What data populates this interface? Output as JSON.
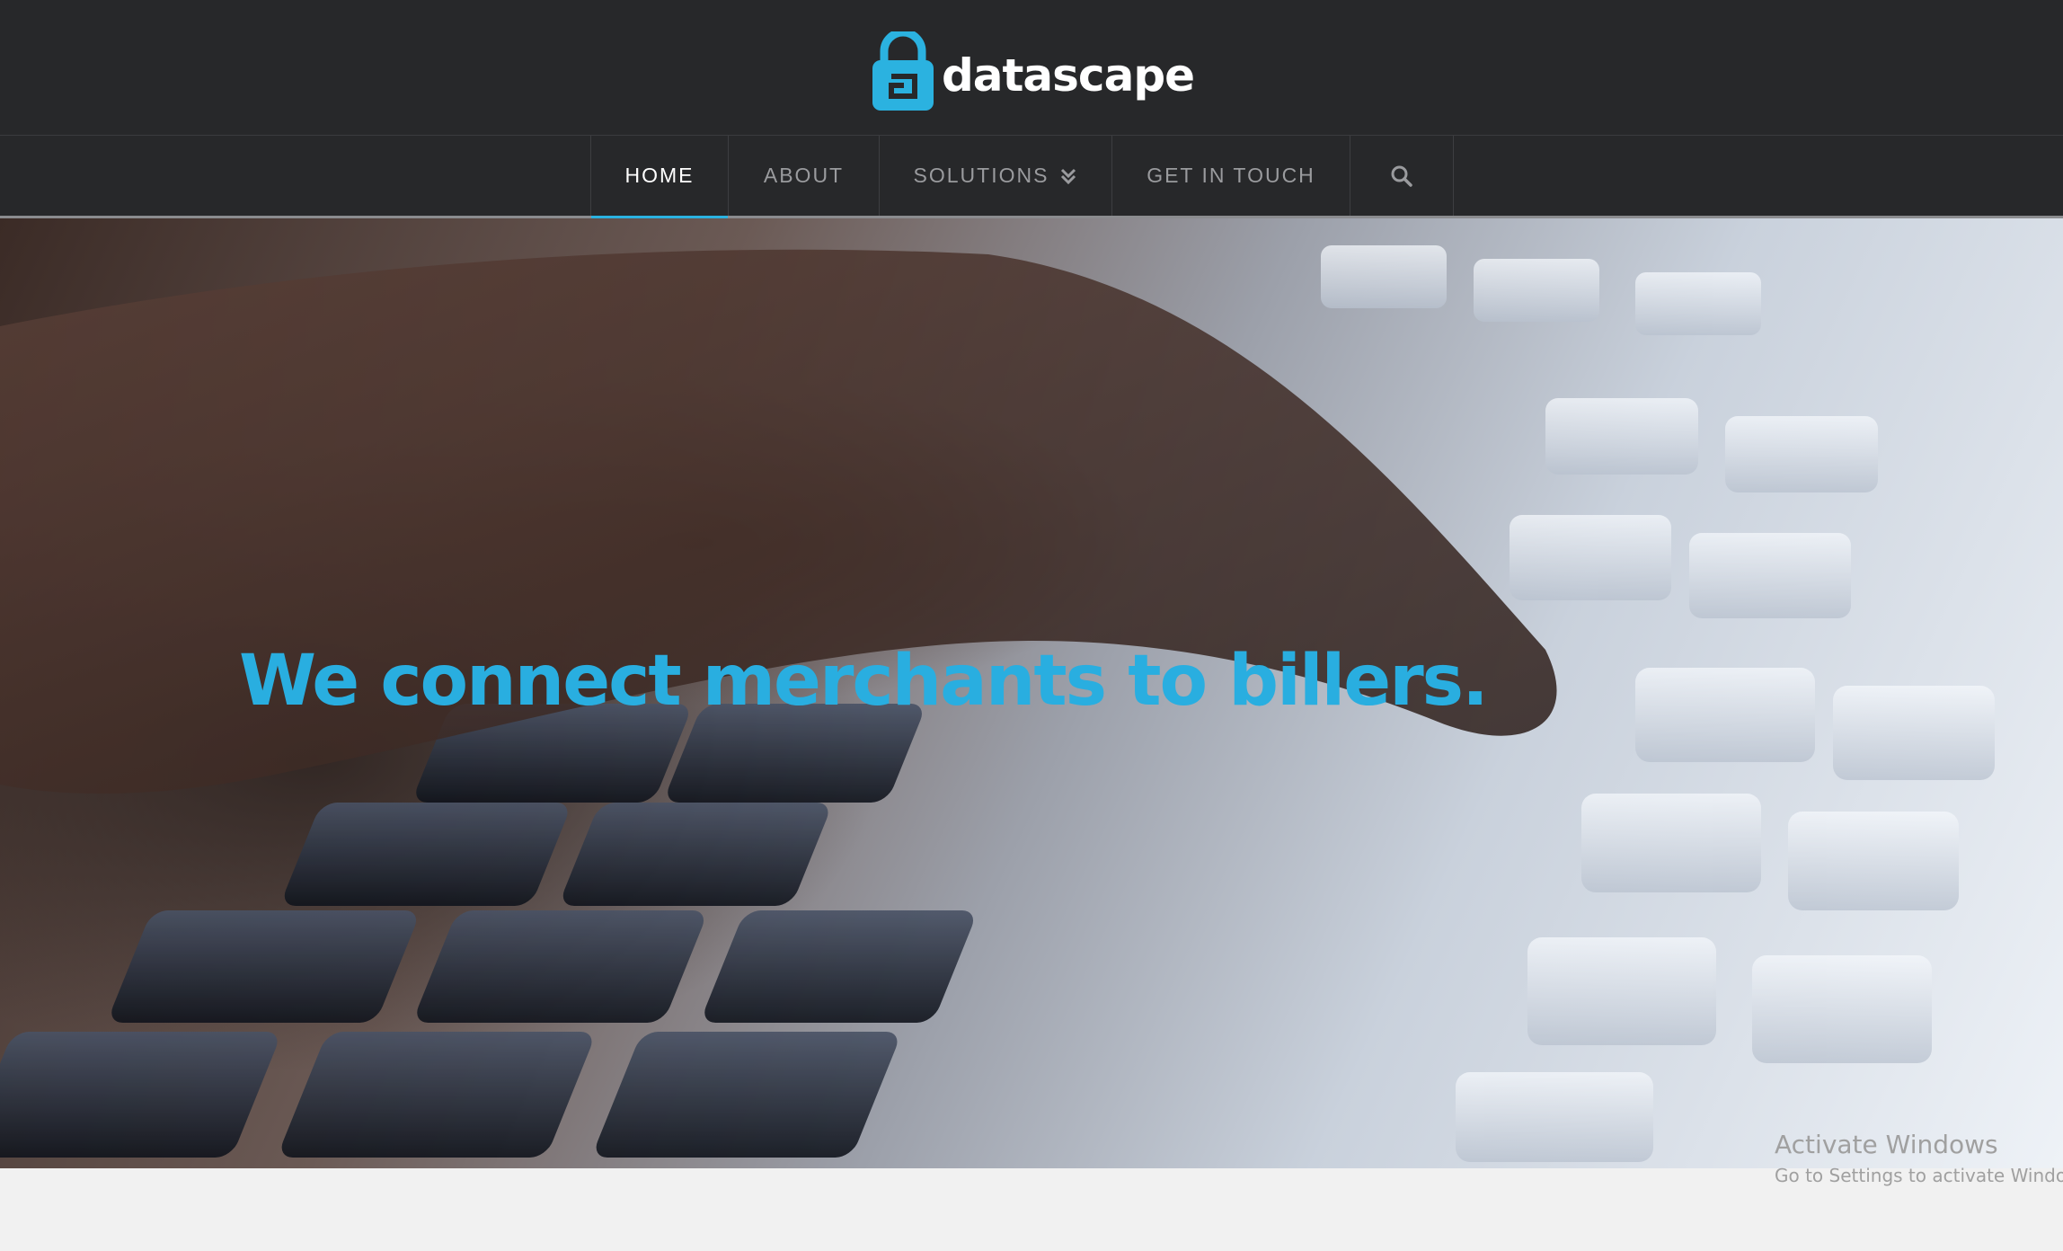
{
  "brand": {
    "name": "datascape",
    "accent_color": "#2bb2e0"
  },
  "nav": {
    "items": [
      {
        "label": "HOME",
        "active": true
      },
      {
        "label": "ABOUT",
        "active": false
      },
      {
        "label": "SOLUTIONS",
        "active": false,
        "icon": "double-chevron-down-icon"
      },
      {
        "label": "GET IN TOUCH",
        "active": false
      }
    ],
    "search_icon": "search-icon"
  },
  "hero": {
    "headline": "We connect merchants to billers."
  },
  "windows_watermark": {
    "title": "Activate Windows",
    "subtitle": "Go to Settings to activate Windows."
  }
}
